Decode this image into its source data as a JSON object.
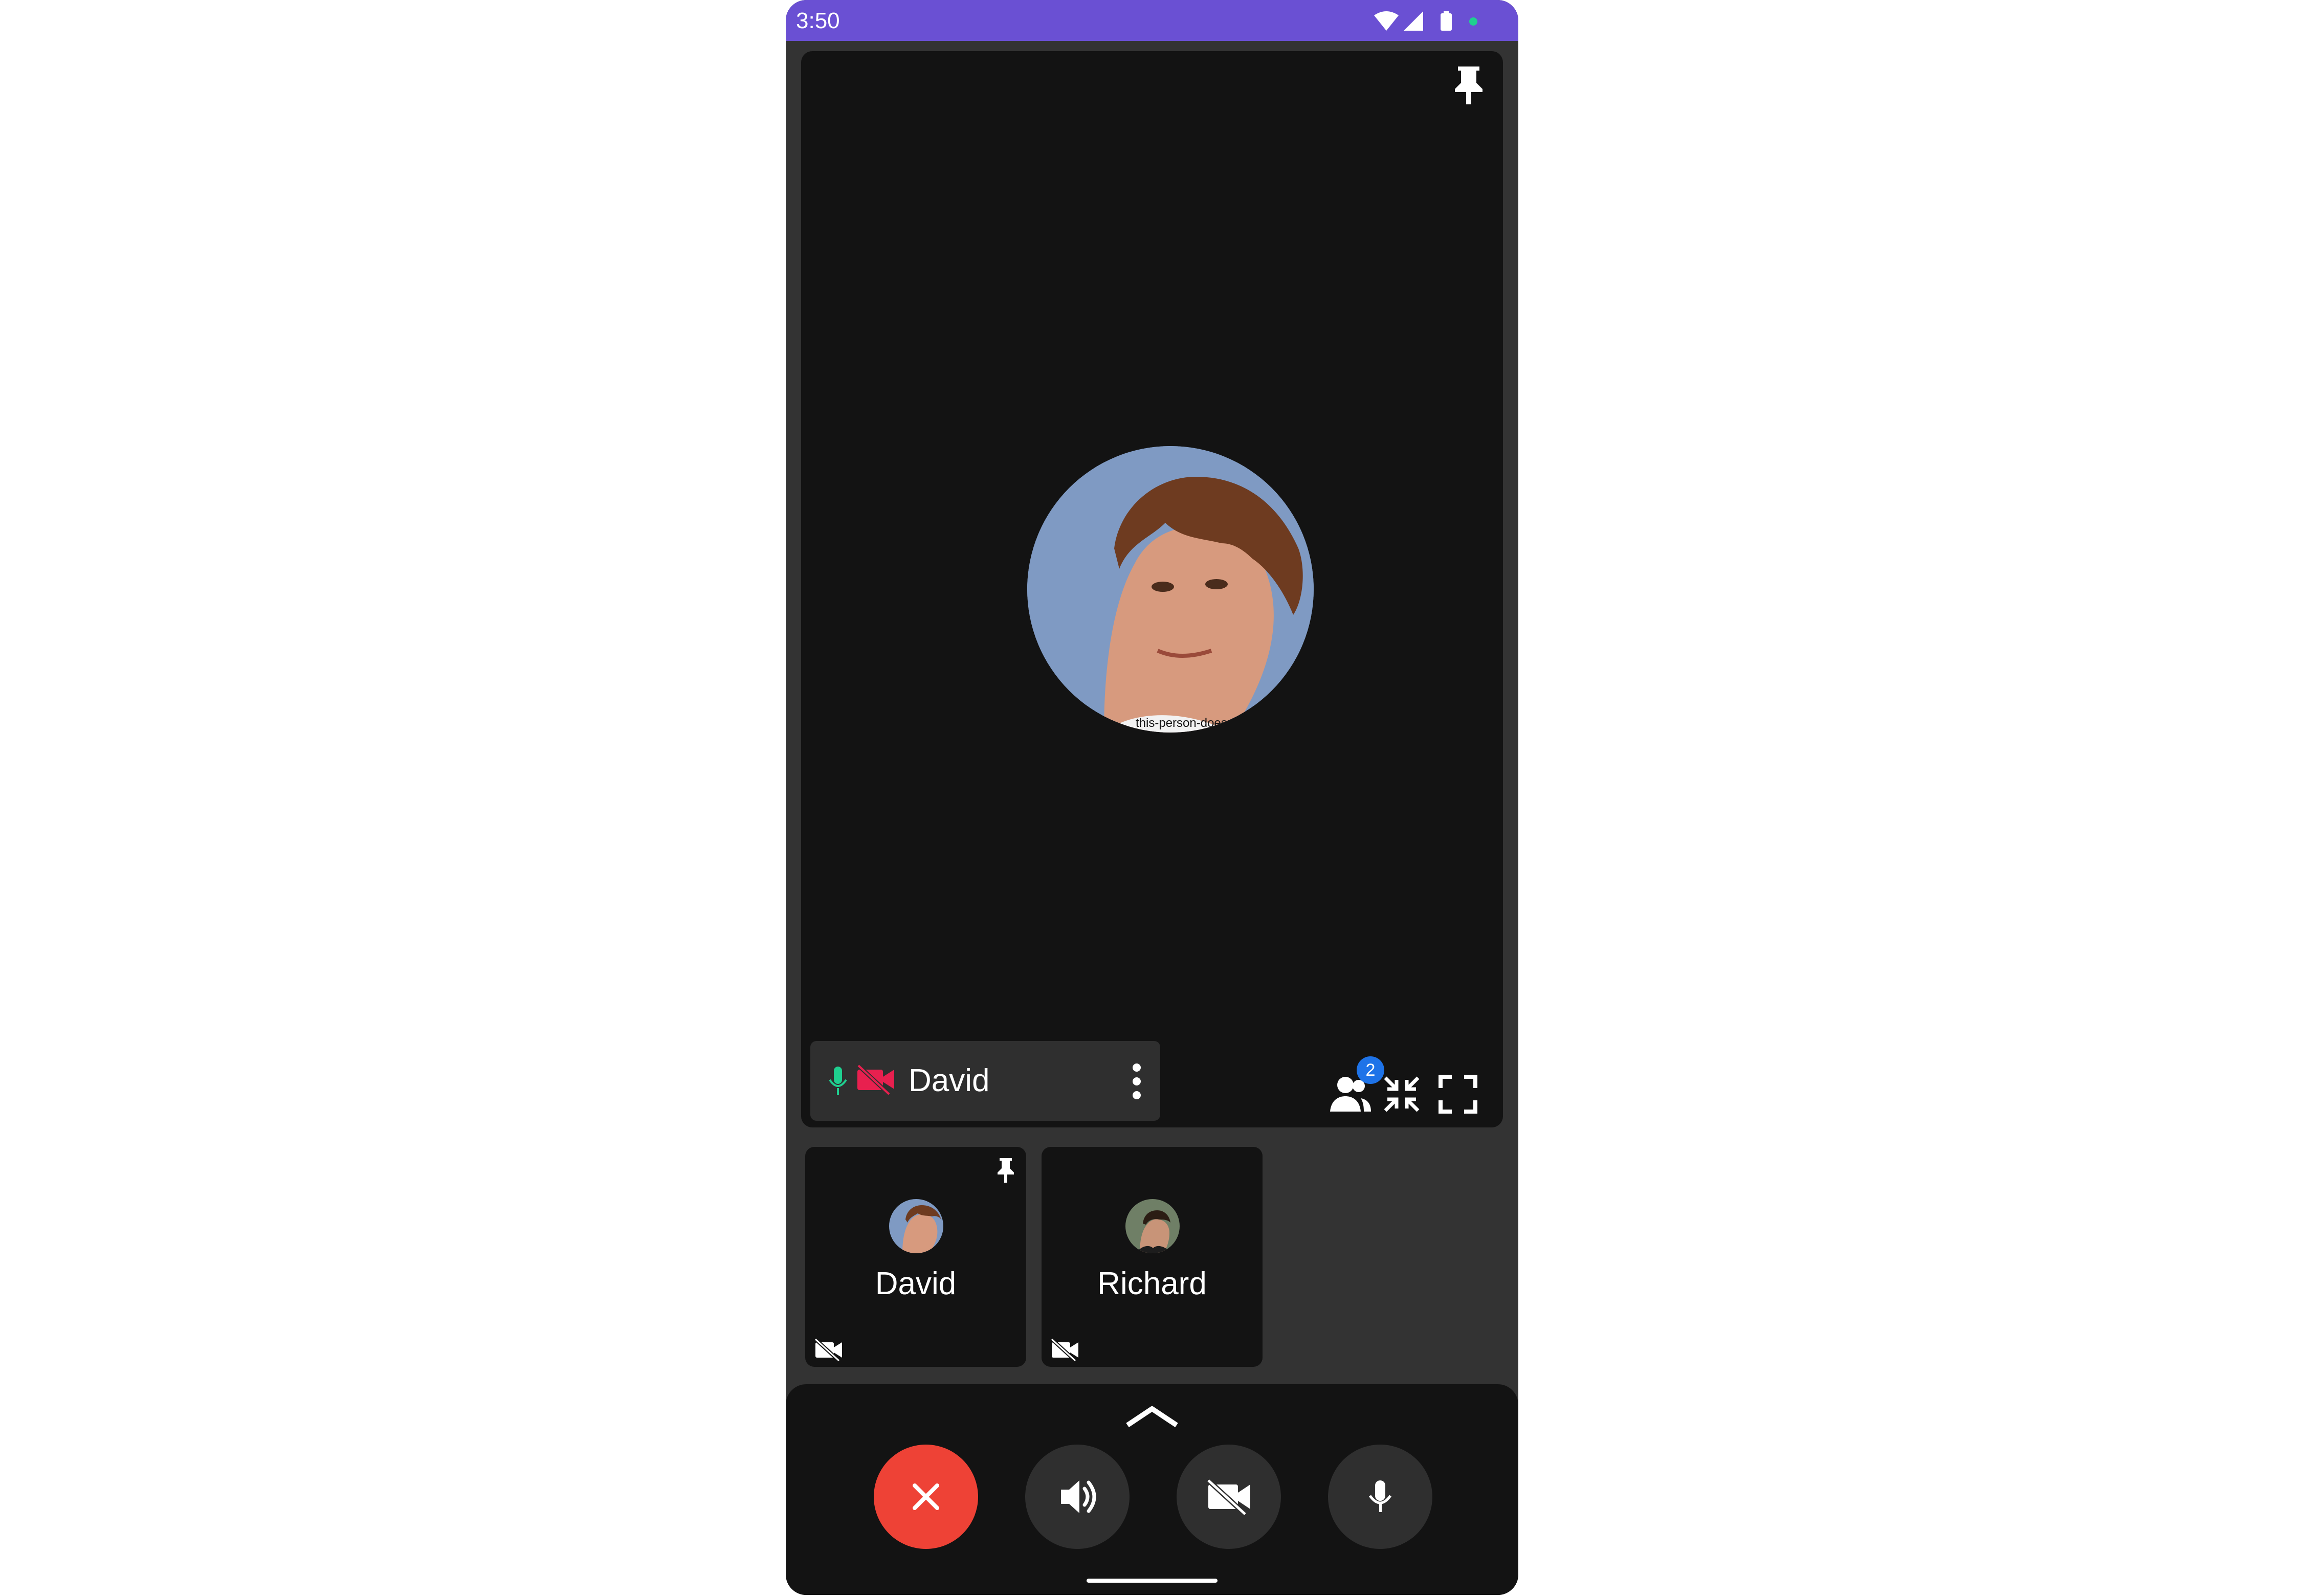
{
  "status_bar": {
    "time": "3:50"
  },
  "main_stage": {
    "participant_name": "David",
    "watermark": "this-person-does",
    "participant_count": "2"
  },
  "tiles": [
    {
      "name": "David",
      "pinned": true
    },
    {
      "name": "Richard",
      "pinned": false
    }
  ],
  "colors": {
    "status_bar": "#6a50d3",
    "end_call": "#ee4236",
    "mic_active": "#1fcf8f",
    "camera_off": "#e8204f",
    "badge": "#1e73e8"
  },
  "icons": {
    "status": [
      "wifi-icon",
      "signal-icon",
      "battery-icon",
      "dot-icon"
    ],
    "main": [
      "pin-icon",
      "mic-icon",
      "camera-off-icon",
      "more-icon",
      "participants-icon",
      "shrink-icon",
      "fullscreen-icon"
    ],
    "controls": [
      "chevron-up-icon",
      "close-icon",
      "speaker-icon",
      "camera-off-icon",
      "mic-icon"
    ]
  }
}
